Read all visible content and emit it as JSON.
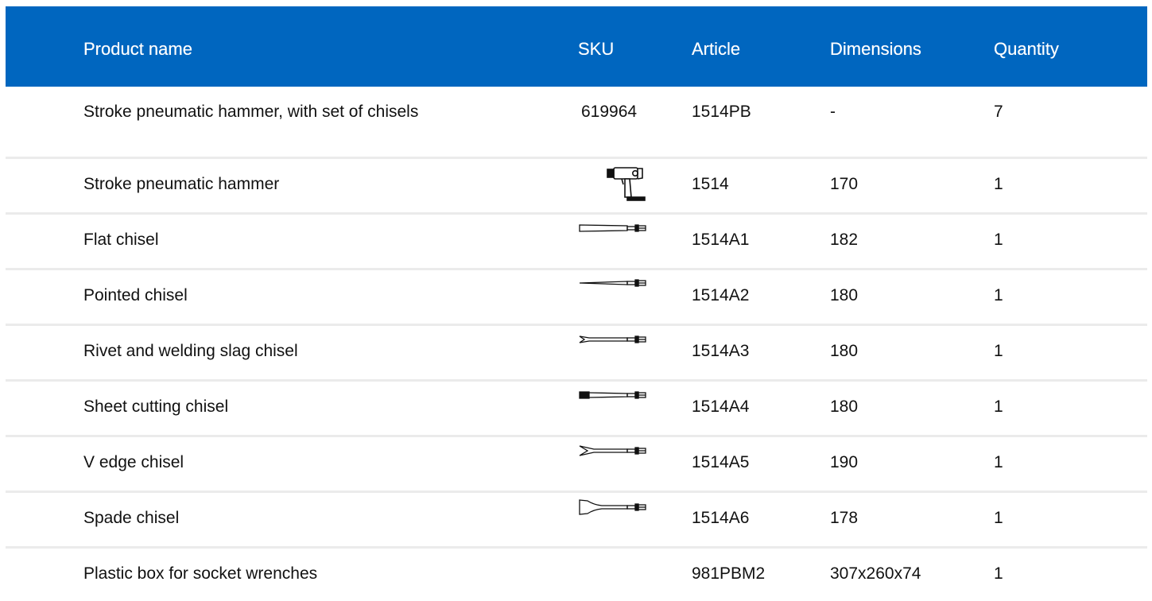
{
  "columns": {
    "name": "Product name",
    "sku": "SKU",
    "article": "Article",
    "dimensions": "Dimensions",
    "quantity": "Quantity"
  },
  "rows": [
    {
      "name": "Stroke pneumatic hammer, with set of chisels",
      "sku": "619964",
      "article": "1514PB",
      "dimensions": "-",
      "quantity": "7",
      "icon": ""
    },
    {
      "name": "Stroke pneumatic hammer",
      "sku": "",
      "article": "1514",
      "dimensions": "170",
      "quantity": "1",
      "icon": "pneumatic-hammer-icon"
    },
    {
      "name": "Flat chisel",
      "sku": "",
      "article": "1514A1",
      "dimensions": "182",
      "quantity": "1",
      "icon": "flat-chisel-icon"
    },
    {
      "name": "Pointed chisel",
      "sku": "",
      "article": "1514A2",
      "dimensions": "180",
      "quantity": "1",
      "icon": "pointed-chisel-icon"
    },
    {
      "name": "Rivet and welding slag chisel",
      "sku": "",
      "article": "1514A3",
      "dimensions": "180",
      "quantity": "1",
      "icon": "rivet-chisel-icon"
    },
    {
      "name": "Sheet cutting chisel",
      "sku": "",
      "article": "1514A4",
      "dimensions": "180",
      "quantity": "1",
      "icon": "sheet-cutting-chisel-icon"
    },
    {
      "name": "V edge chisel",
      "sku": "",
      "article": "1514A5",
      "dimensions": "190",
      "quantity": "1",
      "icon": "v-edge-chisel-icon"
    },
    {
      "name": "Spade chisel",
      "sku": "",
      "article": "1514A6",
      "dimensions": "178",
      "quantity": "1",
      "icon": "spade-chisel-icon"
    },
    {
      "name": "Plastic box for socket wrenches",
      "sku": "",
      "article": "981PBM2",
      "dimensions": "307x260x74",
      "quantity": "1",
      "icon": ""
    }
  ],
  "colors": {
    "header_background": "#0066bf",
    "header_text": "#ffffff",
    "row_divider": "#ebebeb"
  }
}
